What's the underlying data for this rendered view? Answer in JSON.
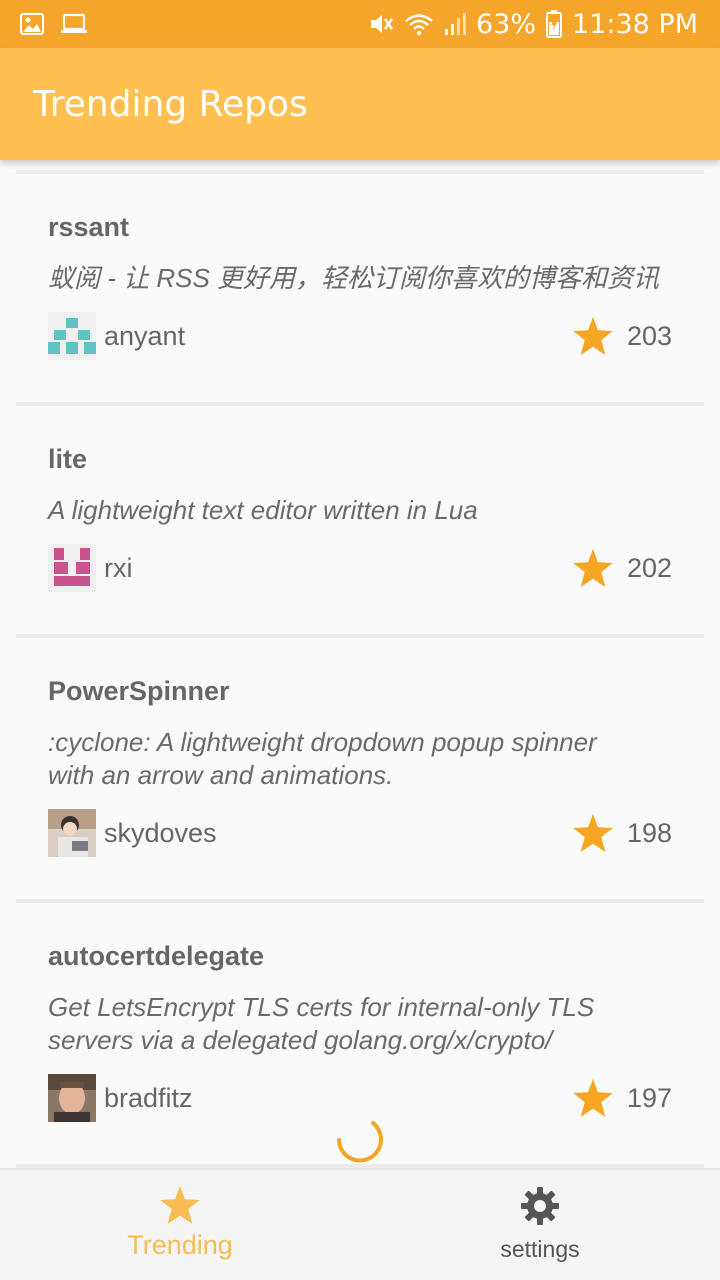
{
  "status_bar": {
    "battery": "63%",
    "time": "11:38 PM"
  },
  "app_bar": {
    "title": "Trending Repos"
  },
  "repos": [
    {
      "name": "rssant",
      "description": "蚁阅 - 让 RSS 更好用，轻松订阅你喜欢的博客和资讯",
      "owner": "anyant",
      "stars": "203"
    },
    {
      "name": "lite",
      "description": "A lightweight text editor written in Lua",
      "owner": "rxi",
      "stars": "202"
    },
    {
      "name": "PowerSpinner",
      "description": ":cyclone: A lightweight dropdown popup spinner with an arrow and animations.",
      "owner": "skydoves",
      "stars": "198"
    },
    {
      "name": "autocertdelegate",
      "description": "Get LetsEncrypt TLS certs for internal-only TLS servers via a delegated golang.org/x/crypto/",
      "owner": "bradfitz",
      "stars": "197"
    }
  ],
  "bottom_nav": {
    "trending_label": "Trending",
    "settings_label": "settings"
  },
  "colors": {
    "status_bar": "#f5a52a",
    "app_bar": "#ffc052",
    "accent": "#f7bd52",
    "star": "#f5a623"
  },
  "icons": {
    "star": "star-icon",
    "settings": "gear-icon"
  }
}
